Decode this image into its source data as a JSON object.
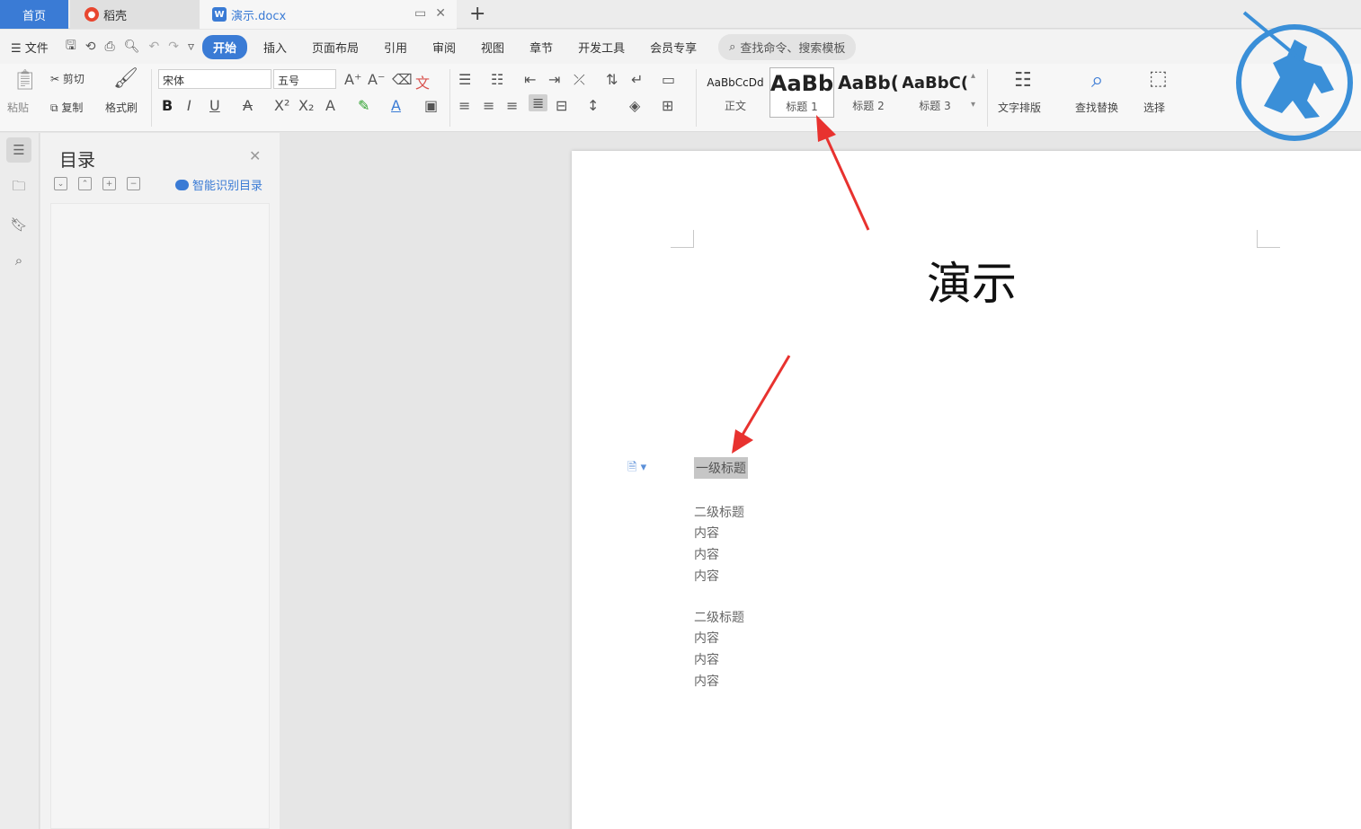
{
  "tabs": {
    "home": "首页",
    "daoke": "稻壳",
    "doc": "演示.docx",
    "add": "+"
  },
  "menu": {
    "file": "文件",
    "items": [
      "开始",
      "插入",
      "页面布局",
      "引用",
      "审阅",
      "视图",
      "章节",
      "开发工具",
      "会员专享"
    ],
    "search": "查找命令、搜索模板"
  },
  "ribbon": {
    "paste": "粘贴",
    "cut": "剪切",
    "copy": "复制",
    "format_painter": "格式刷",
    "font_name": "宋体",
    "font_size": "五号",
    "styles": [
      {
        "sample": "AaBbCcDd",
        "label": "正文"
      },
      {
        "sample": "AaBb",
        "label": "标题 1"
      },
      {
        "sample": "AaBb(",
        "label": "标题 2"
      },
      {
        "sample": "AaBbC(",
        "label": "标题 3"
      }
    ],
    "text_layout": "文字排版",
    "find_replace": "查找替换",
    "select": "选择"
  },
  "toc": {
    "title": "目录",
    "smart": "智能识别目录"
  },
  "document": {
    "title": "演示",
    "lines": [
      {
        "text": "一级标题",
        "kind": "heading1"
      },
      {
        "text": "二级标题",
        "kind": "heading2"
      },
      {
        "text": "内容",
        "kind": "body"
      },
      {
        "text": "内容",
        "kind": "body"
      },
      {
        "text": "内容",
        "kind": "body"
      },
      {
        "text": "二级标题",
        "kind": "heading2"
      },
      {
        "text": "内容",
        "kind": "body"
      },
      {
        "text": "内容",
        "kind": "body"
      },
      {
        "text": "内容",
        "kind": "body"
      }
    ]
  },
  "colors": {
    "accent": "#3a7bd5",
    "arrow": "#e8322f",
    "heading_highlight": "#c6c6c6"
  }
}
